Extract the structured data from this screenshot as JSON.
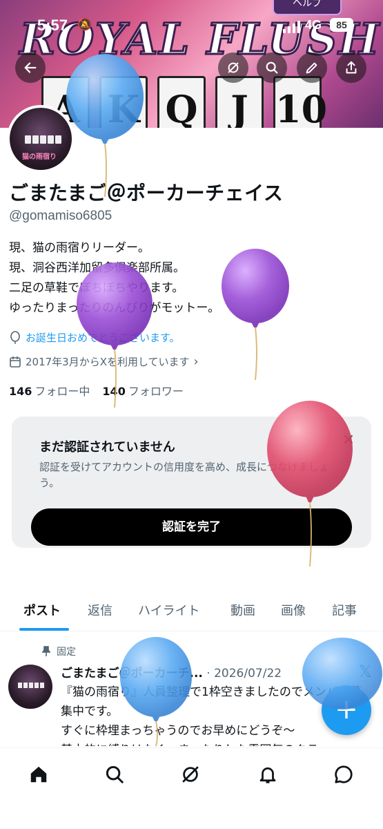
{
  "status_bar": {
    "time": "5:57",
    "network": "4G",
    "battery": "85"
  },
  "banner": {
    "title": "ROYAL FLUSH",
    "help_label": "ヘルプ",
    "cards": [
      "A",
      "K",
      "Q",
      "J",
      "10"
    ]
  },
  "profile": {
    "avatar_text": "猫の雨宿り",
    "name": "ごまたまご＠ポーカーチェイス",
    "handle": "@gomamiso6805",
    "bio": [
      "現、猫の雨宿りリーダー。",
      "現、洞谷西洋加留多倶楽部所属。",
      "二足の草鞋でぼちぼちやります。",
      "ゆったりまったりのんびりがモットー。"
    ],
    "birthday": "お誕生日おめでとうございます。",
    "joined": "2017年3月からXを利用しています",
    "following_count": "146",
    "following_label": "フォロー中",
    "followers_count": "140",
    "followers_label": "フォロワー"
  },
  "verification": {
    "title": "まだ認証されていません",
    "description": "認証を受けてアカウントの信用度を高め、成長につなげましょう。",
    "button": "認証を完了"
  },
  "tabs": [
    "ポスト",
    "返信",
    "ハイライト",
    "動画",
    "画像",
    "記事"
  ],
  "post": {
    "pinned_label": "固定",
    "author": "ごまたまご＠ポーカーチ...",
    "date": "· 2026/07/22",
    "body": "『猫の雨宿り』人員整理で1枠空きましたのでメンバー募集中です。\nすぐに枠埋まっちゃうのでお早めにどうぞ～\n基本的に縛りはなく、まったりした雰囲気のクラ"
  },
  "fab_label": "+",
  "colors": {
    "accent": "#1d9bf0",
    "text_primary": "#0f1419",
    "text_secondary": "#536471",
    "balloon_blue": "#5aaaf2",
    "balloon_purple": "#9b4fd6",
    "balloon_red": "#e24e6e"
  },
  "icons": {
    "header": [
      "back-arrow-icon",
      "grok-icon",
      "search-icon",
      "edit-icon",
      "share-icon"
    ],
    "nav": [
      "home-icon",
      "search-icon",
      "grok-icon",
      "bell-icon",
      "message-icon"
    ]
  }
}
